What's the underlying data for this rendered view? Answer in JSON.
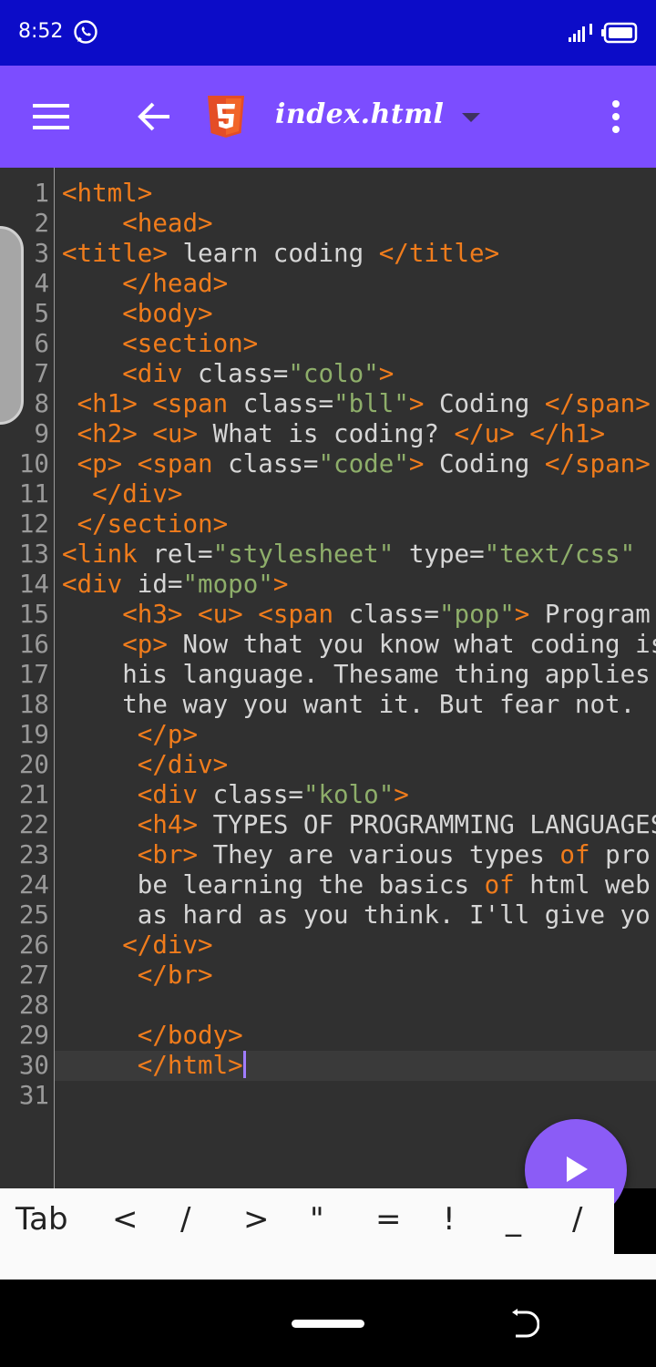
{
  "status_bar": {
    "time": "8:52",
    "icons": [
      "whatsapp-icon",
      "signal-icon",
      "battery-icon"
    ]
  },
  "app_bar": {
    "file_name": "index.html",
    "icons": [
      "menu-icon",
      "back-icon",
      "html5-icon",
      "dropdown-icon",
      "more-vert-icon"
    ],
    "color": "#7c4dff"
  },
  "editor": {
    "background": "#303030",
    "tag_color": "#f07c1c",
    "string_color": "#8eae6a",
    "current_line": 30,
    "lines": [
      {
        "n": "1",
        "t": [
          [
            "t",
            "<html>"
          ]
        ]
      },
      {
        "n": "2",
        "t": [
          [
            "x",
            "    "
          ],
          [
            "t",
            "<head>"
          ]
        ]
      },
      {
        "n": "3",
        "t": [
          [
            "t",
            "<title>"
          ],
          [
            "x",
            " learn coding "
          ],
          [
            "t",
            "</title>"
          ]
        ]
      },
      {
        "n": "4",
        "t": [
          [
            "x",
            "    "
          ],
          [
            "t",
            "</head>"
          ]
        ]
      },
      {
        "n": "5",
        "t": [
          [
            "x",
            "    "
          ],
          [
            "t",
            "<body>"
          ]
        ]
      },
      {
        "n": "6",
        "t": [
          [
            "x",
            "    "
          ],
          [
            "t",
            "<section>"
          ]
        ]
      },
      {
        "n": "7",
        "t": [
          [
            "x",
            "    "
          ],
          [
            "t",
            "<div"
          ],
          [
            "a",
            " class="
          ],
          [
            "s",
            "\"colo\""
          ],
          [
            "t",
            ">"
          ]
        ]
      },
      {
        "n": "8",
        "t": [
          [
            "x",
            " "
          ],
          [
            "t",
            "<h1>"
          ],
          [
            "x",
            " "
          ],
          [
            "t",
            "<span"
          ],
          [
            "a",
            " class="
          ],
          [
            "s",
            "\"bll\""
          ],
          [
            "t",
            ">"
          ],
          [
            "x",
            " Coding "
          ],
          [
            "t",
            "</span>"
          ]
        ]
      },
      {
        "n": "9",
        "t": [
          [
            "x",
            " "
          ],
          [
            "t",
            "<h2>"
          ],
          [
            "x",
            " "
          ],
          [
            "t",
            "<u>"
          ],
          [
            "x",
            " What is coding? "
          ],
          [
            "t",
            "</u>"
          ],
          [
            "x",
            " "
          ],
          [
            "t",
            "</h1>"
          ]
        ]
      },
      {
        "n": "10",
        "t": [
          [
            "x",
            " "
          ],
          [
            "t",
            "<p>"
          ],
          [
            "x",
            " "
          ],
          [
            "t",
            "<span"
          ],
          [
            "a",
            " class="
          ],
          [
            "s",
            "\"code\""
          ],
          [
            "t",
            ">"
          ],
          [
            "x",
            " Coding "
          ],
          [
            "t",
            "</span>"
          ]
        ]
      },
      {
        "n": "11",
        "t": [
          [
            "x",
            "  "
          ],
          [
            "t",
            "</div>"
          ]
        ]
      },
      {
        "n": "12",
        "t": [
          [
            "x",
            " "
          ],
          [
            "t",
            "</section>"
          ]
        ]
      },
      {
        "n": "13",
        "t": [
          [
            "t",
            "<link"
          ],
          [
            "a",
            " rel="
          ],
          [
            "s",
            "\"stylesheet\""
          ],
          [
            "a",
            " type="
          ],
          [
            "s",
            "\"text/css\""
          ]
        ]
      },
      {
        "n": "14",
        "t": [
          [
            "t",
            "<div"
          ],
          [
            "a",
            " id="
          ],
          [
            "s",
            "\"mopo\""
          ],
          [
            "t",
            ">"
          ]
        ]
      },
      {
        "n": "15",
        "t": [
          [
            "x",
            "    "
          ],
          [
            "t",
            "<h3>"
          ],
          [
            "x",
            " "
          ],
          [
            "t",
            "<u>"
          ],
          [
            "x",
            " "
          ],
          [
            "t",
            "<span"
          ],
          [
            "a",
            " class="
          ],
          [
            "s",
            "\"pop\""
          ],
          [
            "t",
            ">"
          ],
          [
            "x",
            " Program"
          ]
        ]
      },
      {
        "n": "16",
        "t": [
          [
            "x",
            "    "
          ],
          [
            "t",
            "<p>"
          ],
          [
            "x",
            " Now that you know what coding is"
          ]
        ]
      },
      {
        "n": "17",
        "t": [
          [
            "x",
            "    his language. Thesame thing applies"
          ]
        ]
      },
      {
        "n": "18",
        "t": [
          [
            "x",
            "    the way you want it. But fear not."
          ]
        ]
      },
      {
        "n": "19",
        "t": [
          [
            "x",
            "     "
          ],
          [
            "t",
            "</p>"
          ]
        ]
      },
      {
        "n": "20",
        "t": [
          [
            "x",
            "     "
          ],
          [
            "t",
            "</div>"
          ]
        ]
      },
      {
        "n": "21",
        "t": [
          [
            "x",
            "     "
          ],
          [
            "t",
            "<div"
          ],
          [
            "a",
            " class="
          ],
          [
            "s",
            "\"kolo\""
          ],
          [
            "t",
            ">"
          ]
        ]
      },
      {
        "n": "22",
        "t": [
          [
            "x",
            "     "
          ],
          [
            "t",
            "<h4>"
          ],
          [
            "x",
            " TYPES OF PROGRAMMING LANGUAGES"
          ]
        ]
      },
      {
        "n": "23",
        "t": [
          [
            "x",
            "     "
          ],
          [
            "t",
            "<br>"
          ],
          [
            "x",
            " They are various types "
          ],
          [
            "t",
            "of"
          ],
          [
            "x",
            " pro"
          ]
        ]
      },
      {
        "n": "24",
        "t": [
          [
            "x",
            "     be learning the basics "
          ],
          [
            "t",
            "of"
          ],
          [
            "x",
            " html web"
          ]
        ]
      },
      {
        "n": "25",
        "t": [
          [
            "x",
            "     as hard as you think. I'll give yo"
          ]
        ]
      },
      {
        "n": "26",
        "t": [
          [
            "x",
            "    "
          ],
          [
            "t",
            "</div>"
          ]
        ]
      },
      {
        "n": "27",
        "t": [
          [
            "x",
            "     "
          ],
          [
            "t",
            "</br>"
          ]
        ]
      },
      {
        "n": "28",
        "t": []
      },
      {
        "n": "29",
        "t": [
          [
            "x",
            "     "
          ],
          [
            "t",
            "</body>"
          ]
        ]
      },
      {
        "n": "30",
        "t": [
          [
            "x",
            "     "
          ],
          [
            "t",
            "</html>"
          ]
        ]
      },
      {
        "n": "31",
        "t": []
      }
    ]
  },
  "run_button": {
    "icon": "play-icon",
    "color": "#8b5cf6"
  },
  "symbol_bar": {
    "keys": [
      "Tab",
      "<",
      "/",
      ">",
      "\"",
      "=",
      "!",
      "_",
      "/"
    ]
  },
  "nav_bar": {
    "icons": [
      "home-pill",
      "rotate-icon"
    ]
  }
}
